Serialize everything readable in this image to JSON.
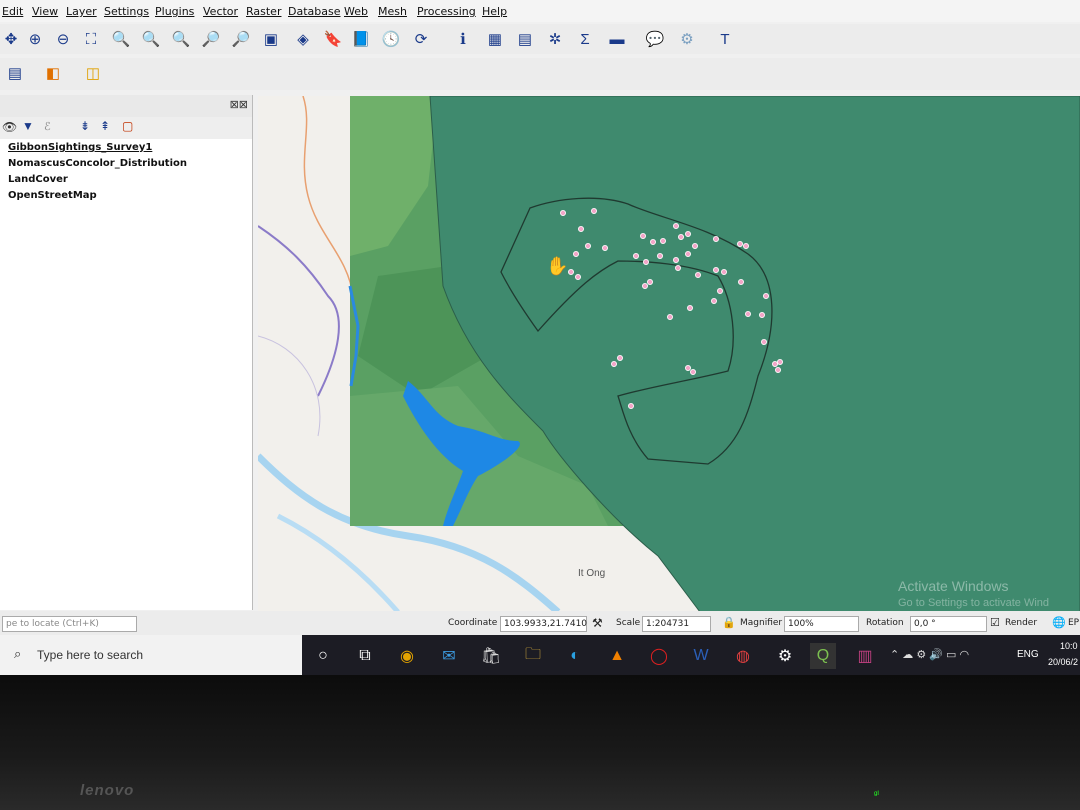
{
  "menu": [
    "Edit",
    "View",
    "Layer",
    "Settings",
    "Plugins",
    "Vector",
    "Raster",
    "Database",
    "Web",
    "Mesh",
    "Processing",
    "Help"
  ],
  "layers_panel": {
    "layers": [
      "GibbonSightings_Survey1",
      "NomascusConcolor_Distribution",
      "LandCover",
      "OpenStreetMap"
    ],
    "locate_placeholder": "pe to locate (Ctrl+K)"
  },
  "map": {
    "place_label": "It Ong",
    "watermark_title": "Activate Windows",
    "watermark_sub": "Go to Settings to activate Wind",
    "colors": {
      "distribution_fill": "#3f8a6e",
      "landcover_green": "#5aa063",
      "water": "#1e88e5",
      "points": "#f2a6c8"
    }
  },
  "status": {
    "coordinate_label": "Coordinate",
    "coordinate_value": "103.9933,21.7410",
    "scale_label": "Scale",
    "scale_value": "1:204731",
    "magnifier_label": "Magnifier",
    "magnifier_value": "100%",
    "rotation_label": "Rotation",
    "rotation_value": "0,0 °",
    "render_label": "Render",
    "crs_label": "EP"
  },
  "taskbar": {
    "search_placeholder": "Type here to search",
    "language": "ENG",
    "time": "10:0",
    "date": "20/06/2"
  },
  "laptop": {
    "brand": "lenovo"
  }
}
